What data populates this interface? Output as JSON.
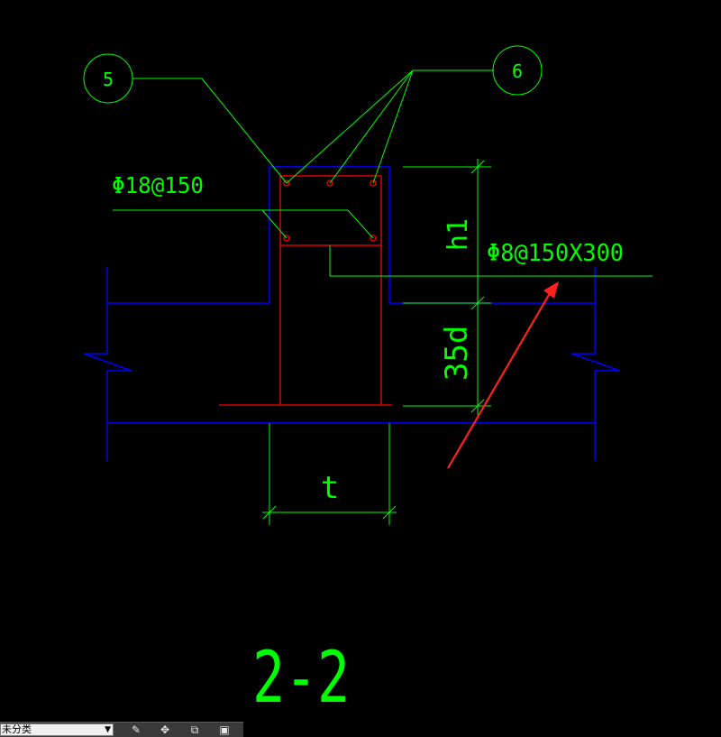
{
  "drawing": {
    "callouts": [
      {
        "id": "callout-5",
        "label": "5"
      },
      {
        "id": "callout-6",
        "label": "6"
      }
    ],
    "rebar_labels": {
      "top_bars": "Φ18@150",
      "stirrups": "Φ8@150X300"
    },
    "dimension_labels": {
      "h1": "h1",
      "anchorage": "35d",
      "thickness": "t"
    },
    "section_title": "2-2",
    "colors": {
      "background": "#000000",
      "wall_outline": "#0000ff",
      "rebar": "#ff0000",
      "annotation": "#00ff00",
      "leader_arrow": "#ff2020"
    }
  },
  "toolbar": {
    "layer_select_value": "未分类",
    "icons": [
      "edit-icon",
      "move-icon",
      "copy-icon",
      "paste-icon"
    ]
  }
}
